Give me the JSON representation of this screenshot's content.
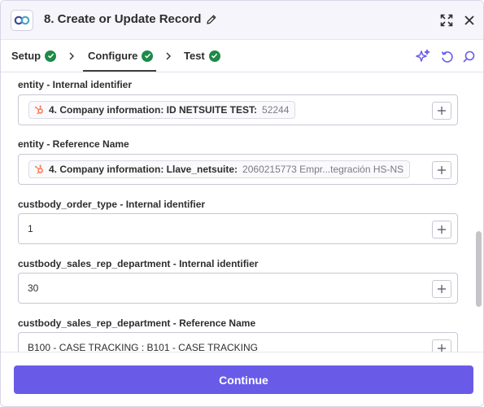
{
  "header": {
    "title": "8. Create or Update Record",
    "icons": {
      "logo": "app-logo-icon",
      "edit": "pencil-icon",
      "expand": "expand-icon",
      "close": "close-icon"
    }
  },
  "tabs": [
    {
      "label": "Setup",
      "status": "complete"
    },
    {
      "label": "Configure",
      "status": "complete",
      "active": true
    },
    {
      "label": "Test",
      "status": "complete"
    }
  ],
  "toolbar": {
    "icons": [
      "sparkle-icon",
      "refresh-icon",
      "search-icon"
    ]
  },
  "fields": [
    {
      "label": "entity - Internal identifier",
      "pill": {
        "icon": "hubspot-icon",
        "label": "4. Company information: ID NETSUITE TEST:",
        "value": "52244"
      }
    },
    {
      "label": "entity - Reference Name",
      "pill": {
        "icon": "hubspot-icon",
        "label": "4. Company information: Llave_netsuite:",
        "value": "2060215773 Empr...tegración HS-NS"
      }
    },
    {
      "label": "custbody_order_type - Internal identifier",
      "value": "1"
    },
    {
      "label": "custbody_sales_rep_department - Internal identifier",
      "value": "30"
    },
    {
      "label": "custbody_sales_rep_department - Reference Name",
      "value": "B100 - CASE TRACKING : B101 - CASE TRACKING"
    }
  ],
  "footer": {
    "continue_label": "Continue"
  },
  "colors": {
    "accent": "#695be8",
    "success": "#1f8a48",
    "hubspot": "#ff7a59"
  }
}
